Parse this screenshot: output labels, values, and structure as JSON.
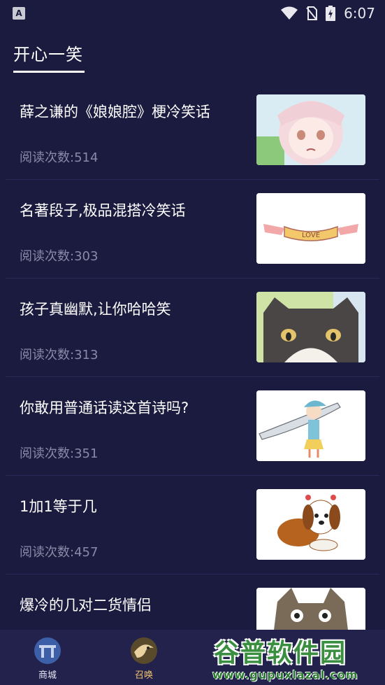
{
  "status_bar": {
    "app_badge": "A",
    "time": "6:07",
    "icons": [
      "wifi-icon",
      "no-sim-icon",
      "battery-charging-icon"
    ]
  },
  "header": {
    "title": "开心一笑"
  },
  "articles": [
    {
      "title": "薛之谦的《娘娘腔》梗冷笑话",
      "reads": "阅读次数:514",
      "thumbnail": "anime-girl-illustration"
    },
    {
      "title": "名著段子,极品混搭冷笑话",
      "reads": "阅读次数:303",
      "thumbnail": "love-banner-illustration"
    },
    {
      "title": "孩子真幽默,让你哈哈笑",
      "reads": "阅读次数:313",
      "thumbnail": "black-cat-illustration"
    },
    {
      "title": "你敢用普通话读这首诗吗?",
      "reads": "阅读次数:351",
      "thumbnail": "girl-with-sword-illustration"
    },
    {
      "title": "1加1等于几",
      "reads": "阅读次数:457",
      "thumbnail": "puppy-illustration"
    },
    {
      "title": "爆冷的几对二货情侣",
      "reads": "",
      "thumbnail": "totoro-illustration"
    }
  ],
  "bottom_nav": {
    "items": [
      {
        "label": "商城",
        "icon": "shop-gate-icon",
        "active": false
      },
      {
        "label": "召唤",
        "icon": "eagle-icon",
        "active": true
      }
    ]
  },
  "watermark": {
    "title": "谷普软件园",
    "url": "www.gupuxlazal.com"
  }
}
